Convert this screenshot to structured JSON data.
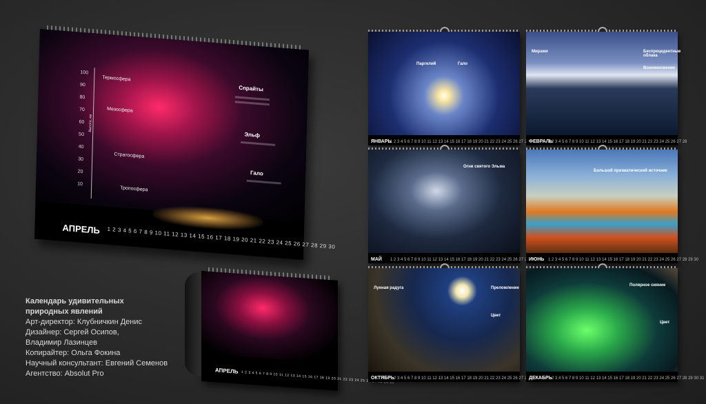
{
  "big_calendar": {
    "month": "АПРЕЛЬ",
    "ticks": [
      "100",
      "90",
      "80",
      "70",
      "60",
      "50",
      "40",
      "30",
      "20",
      "10"
    ],
    "layers": [
      "Термосфера",
      "Мезосфера",
      "Стратосфера",
      "Тропосфера"
    ],
    "axis_label": "Высота, км",
    "annotations": [
      "Спрайты",
      "Эльф",
      "Гало"
    ],
    "days": "1 2 3 4 5 6 7 8 9 10 11 12 13 14 15 16 17 18 19 20 21 22 23 24 25 26 27 28 29 30"
  },
  "small_calendar": {
    "month": "АПРЕЛЬ",
    "days": "1 2 3 4 5 6 7 8 9 10 11 12 13 14 15 16 17 18 19 20 21 22 23 24 25 26 27 28 29 30"
  },
  "credits": {
    "title1": "Календарь удивительных",
    "title2": "природных явлений",
    "art": "Арт-директор: Клубничкин Денис",
    "design1": "Дизайнер: Сергей Осипов,",
    "design2": "Владимир Лазинцев",
    "copy": "Копирайтер: Ольга Фокина",
    "sci": "Научный консультант: Евгений Семенов",
    "agency": "Агентство: Absolut Pro"
  },
  "walls": [
    {
      "month": "ЯНВАРЬ",
      "t1": "Паргелий",
      "t2": "Гало",
      "days": "1 2 3 4 5 6 7 8 9 10 11 12 13 14 15 16 17 18 19 20 21 22 23 24 25 26 27 28 29 30 31"
    },
    {
      "month": "ФЕВРАЛЬ",
      "t1": "Миражи",
      "t2": "Беспрецедентные облака",
      "t3": "Возникновение",
      "days": "1 2 3 4 5 6 7 8 9 10 11 12 13 14 15 16 17 18 19 20 21 22 23 24 25 26 27 28"
    },
    {
      "month": "МАЙ",
      "t1": "Огни святого Эльма",
      "days": "1 2 3 4 5 6 7 8 9 10 11 12 13 14 15 16 17 18 19 20 21 22 23 24 25 26 27 28 29 30 31"
    },
    {
      "month": "ИЮНЬ",
      "t1": "Большой призматический источник",
      "days": "1 2 3 4 5 6 7 8 9 10 11 12 13 14 15 16 17 18 19 20 21 22 23 24 25 26 27 28 29 30"
    },
    {
      "month": "ОКТЯБРЬ",
      "t1": "Лунная радуга",
      "t2": "Преломление",
      "t3": "Цвет",
      "days": "1 2 3 4 5 6 7 8 9 10 11 12 13 14 15 16 17 18 19 20 21 22 23 24 25 26 27 28 29 30 31"
    },
    {
      "month": "ДЕКАБРЬ",
      "t1": "Полярное сияние",
      "t2": "Цвет",
      "days": "1 2 3 4 5 6 7 8 9 10 11 12 13 14 15 16 17 18 19 20 21 22 23 24 25 26 27 28 29 30 31"
    }
  ]
}
